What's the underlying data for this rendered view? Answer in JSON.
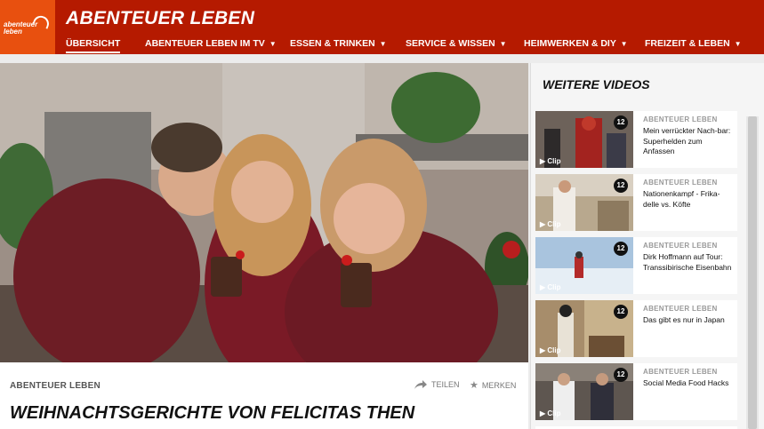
{
  "header": {
    "logo_text": "abenteuer leben",
    "site_title": "ABENTEUER LEBEN",
    "nav": [
      {
        "label": "ÜBERSICHT",
        "caret": ""
      },
      {
        "label": "ABENTEUER LEBEN IM TV",
        "caret": "▼"
      },
      {
        "label": "ESSEN & TRINKEN",
        "caret": "▼"
      },
      {
        "label": "SERVICE & WISSEN",
        "caret": "▼"
      },
      {
        "label": "HEIMWERKEN & DIY",
        "caret": "▼"
      },
      {
        "label": "FREIZEIT & LEBEN",
        "caret": "▼"
      }
    ]
  },
  "article": {
    "kicker": "ABENTEUER LEBEN",
    "share_label": "TEILEN",
    "save_label": "MERKEN",
    "headline": "WEIHNACHTSGERICHTE VON FELICITAS THEN"
  },
  "sidebar": {
    "title": "WEITERE VIDEOS",
    "cards": [
      {
        "badge": "12",
        "clip": "▶ Clip",
        "kicker": "ABENTEUER LEBEN",
        "title": "Mein verrückter Nach-bar: Superhelden zum Anfassen"
      },
      {
        "badge": "12",
        "clip": "▶ Clip",
        "kicker": "ABENTEUER LEBEN",
        "title": "Nationenkampf - Frika-delle vs. Köfte"
      },
      {
        "badge": "12",
        "clip": "▶ Clip",
        "kicker": "ABENTEUER LEBEN",
        "title": "Dirk Hoffmann auf Tour: Transsibirische Eisenbahn"
      },
      {
        "badge": "12",
        "clip": "▶ Clip",
        "kicker": "ABENTEUER LEBEN",
        "title": "Das gibt es nur in Japan"
      },
      {
        "badge": "12",
        "clip": "▶ Clip",
        "kicker": "ABENTEUER LEBEN",
        "title": "Social Media Food Hacks"
      }
    ]
  },
  "colors": {
    "header_bg": "#b51a00",
    "logo_bg": "#e8500f"
  }
}
